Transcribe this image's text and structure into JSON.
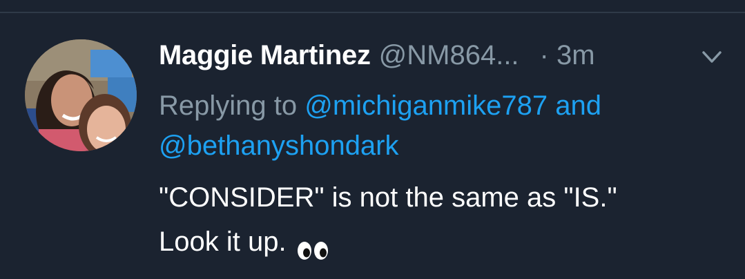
{
  "tweet": {
    "display_name": "Maggie Martinez",
    "handle": "@NM864...",
    "separator": "·",
    "time": "3m",
    "reply_prefix": "Replying to",
    "reply_mention_1": "@michiganmike787",
    "reply_joiner": "and",
    "reply_mention_2": "@bethanyshondark",
    "text_line_1": "\"CONSIDER\" is not the same as \"IS.\"",
    "text_line_2": "Look it up.",
    "emoji": "eyes-emoji",
    "avatar": "profile-photo"
  },
  "colors": {
    "background": "#1b2330",
    "name": "#ffffff",
    "meta": "#8899a6",
    "link": "#1da1f2"
  }
}
